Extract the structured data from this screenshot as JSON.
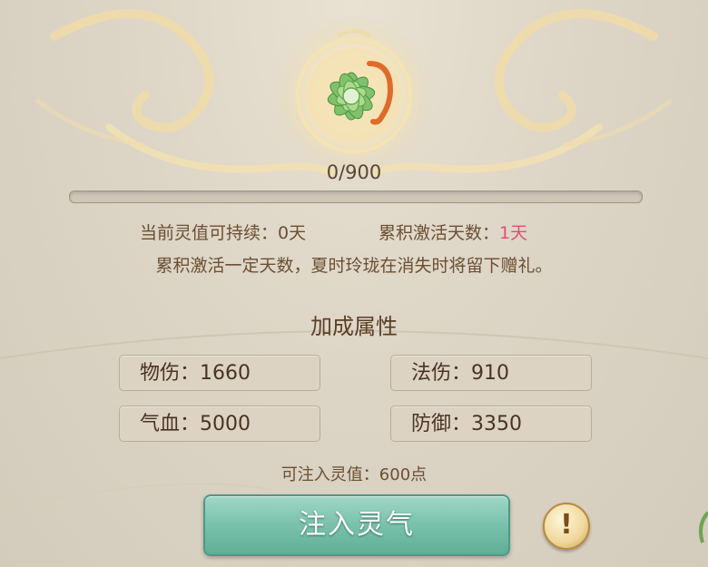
{
  "progress": {
    "text": "0/900",
    "fraction": 0
  },
  "info": {
    "duration_label": "当前灵值可持续：",
    "duration_value": "0天",
    "accum_label": "累积激活天数：",
    "accum_value": "1天",
    "hint": "累积激活一定天数，夏时玲珑在消失时将留下赠礼。"
  },
  "bonus": {
    "title": "加成属性",
    "stats": [
      {
        "label": "物伤：1660"
      },
      {
        "label": "法伤：910"
      },
      {
        "label": "气血：5000"
      },
      {
        "label": "防御：3350"
      }
    ]
  },
  "inject": {
    "points_text": "可注入灵值：600点",
    "button_label": "注入灵气",
    "info_button_glyph": "!"
  },
  "icons": {
    "emblem": "jade-lotus-flower-icon",
    "info": "exclamation-icon"
  },
  "colors": {
    "accent_pink": "#e0507a",
    "button_green": "#7cc3ad",
    "text_brown": "#6b4f33"
  }
}
